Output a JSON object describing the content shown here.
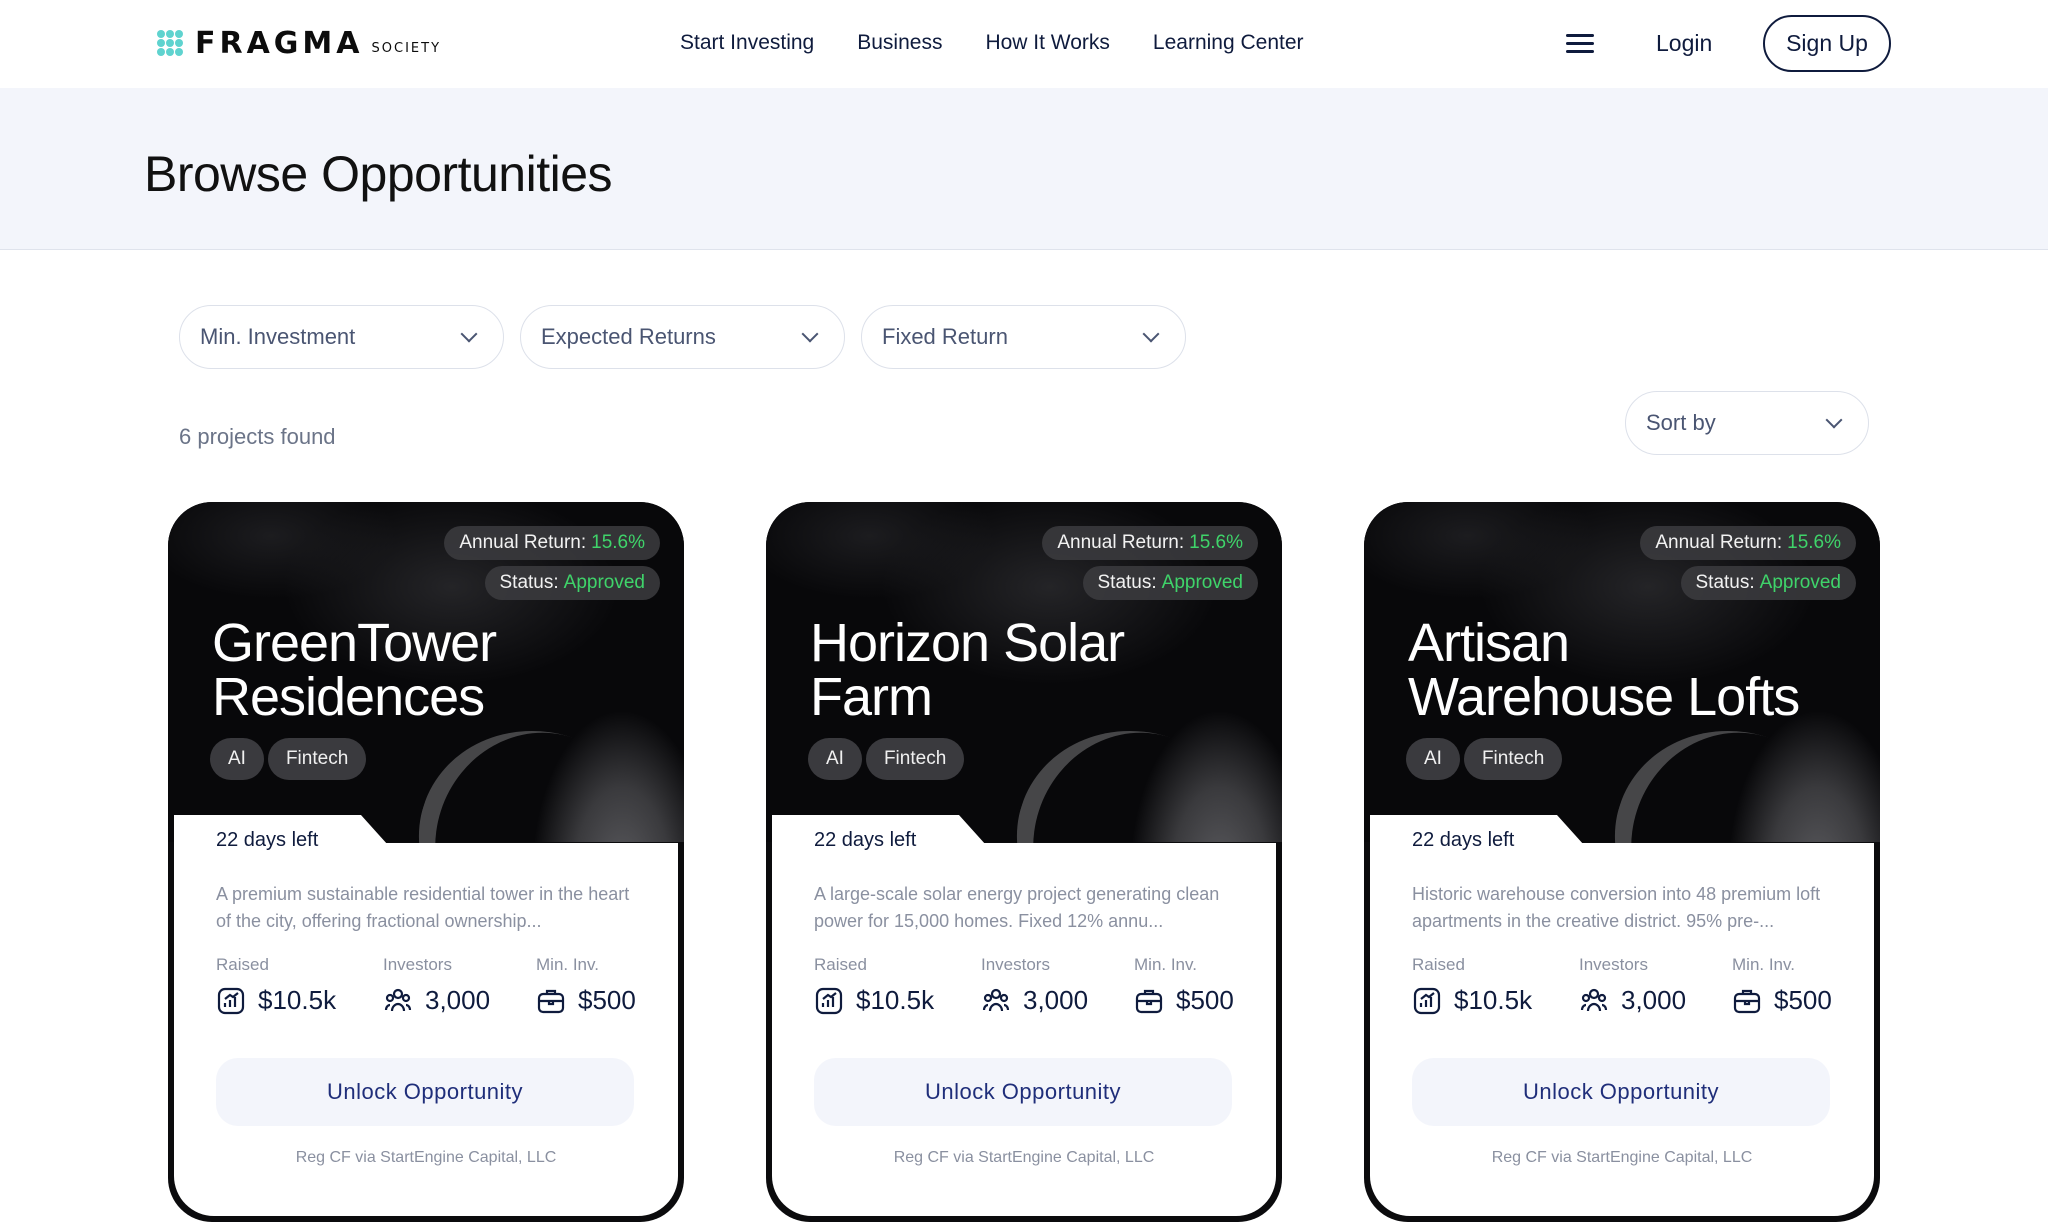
{
  "brand": {
    "name": "FRAGMA",
    "sub": "SOCIETY",
    "accent": "#5fd3cf"
  },
  "nav": {
    "items": [
      "Start Investing",
      "Business",
      "How It Works",
      "Learning Center"
    ],
    "menu_icon": "hamburger-menu-icon",
    "login": "Login",
    "signup": "Sign Up"
  },
  "page": {
    "title": "Browse Opportunities"
  },
  "filters": {
    "items": [
      "Min. Investment",
      "Expected Returns",
      "Fixed Return"
    ],
    "sort_label": "Sort by",
    "results_count": "6 projects found"
  },
  "colors": {
    "status_green": "#3fd46a",
    "primary_text": "#0f1b3d",
    "button_text": "#1f2e7a"
  },
  "cards": [
    {
      "annual_return_label": "Annual Return:",
      "annual_return": "15.6%",
      "status_label": "Status:",
      "status": "Approved",
      "title": "GreenTower Residences",
      "tags": [
        "AI",
        "Fintech"
      ],
      "days_left": "22 days left",
      "description": "A premium sustainable residential tower in the heart of the city, offering fractional ownership...",
      "stats": {
        "raised_label": "Raised",
        "raised": "$10.5k",
        "investors_label": "Investors",
        "investors": "3,000",
        "min_label": "Min. Inv.",
        "min": "$500"
      },
      "cta": "Unlock Opportunity",
      "footer": "Reg CF via StartEngine Capital, LLC"
    },
    {
      "annual_return_label": "Annual Return:",
      "annual_return": "15.6%",
      "status_label": "Status:",
      "status": "Approved",
      "title": "Horizon Solar Farm",
      "tags": [
        "AI",
        "Fintech"
      ],
      "days_left": "22 days left",
      "description": "A large-scale solar energy project generating clean power for 15,000 homes. Fixed 12% annu...",
      "stats": {
        "raised_label": "Raised",
        "raised": "$10.5k",
        "investors_label": "Investors",
        "investors": "3,000",
        "min_label": "Min. Inv.",
        "min": "$500"
      },
      "cta": "Unlock Opportunity",
      "footer": "Reg CF via StartEngine Capital, LLC"
    },
    {
      "annual_return_label": "Annual Return:",
      "annual_return": "15.6%",
      "status_label": "Status:",
      "status": "Approved",
      "title": "Artisan Warehouse Lofts",
      "tags": [
        "AI",
        "Fintech"
      ],
      "days_left": "22 days left",
      "description": "Historic warehouse conversion into 48 premium loft apartments in the creative district. 95% pre-...",
      "stats": {
        "raised_label": "Raised",
        "raised": "$10.5k",
        "investors_label": "Investors",
        "investors": "3,000",
        "min_label": "Min. Inv.",
        "min": "$500"
      },
      "cta": "Unlock Opportunity",
      "footer": "Reg CF via StartEngine Capital, LLC"
    }
  ]
}
